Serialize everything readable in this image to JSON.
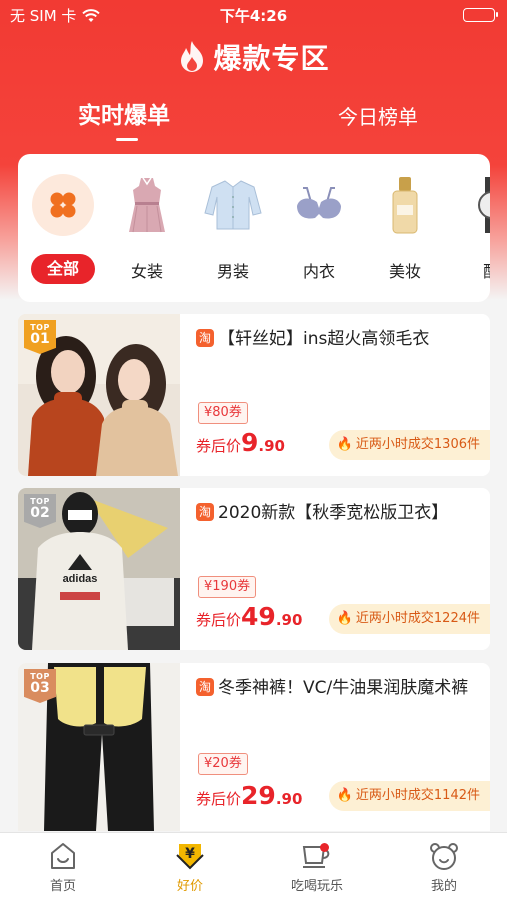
{
  "status_bar": {
    "carrier": "无 SIM 卡",
    "time": "下午4:26"
  },
  "header": {
    "title": "爆款专区"
  },
  "tabs": [
    {
      "label": "实时爆单",
      "active": true
    },
    {
      "label": "今日榜单",
      "active": false
    }
  ],
  "categories": [
    {
      "label": "全部",
      "icon": "clover-icon",
      "active": true
    },
    {
      "label": "女装",
      "icon": "dress-icon"
    },
    {
      "label": "男装",
      "icon": "shirt-icon"
    },
    {
      "label": "内衣",
      "icon": "bra-icon"
    },
    {
      "label": "美妆",
      "icon": "cosmetics-bottle-icon"
    },
    {
      "label": "配",
      "icon": "watch-icon"
    }
  ],
  "products": [
    {
      "rank_top": "TOP",
      "rank": "01",
      "rank_color": "#f0a020",
      "source_icon": "淘",
      "title": "【轩丝妃】ins超火高领毛衣",
      "coupon": "¥80券",
      "price_label": "券后价",
      "price_int": "9",
      "price_dec": ".90",
      "sales": "近两小时成交1306件"
    },
    {
      "rank_top": "TOP",
      "rank": "02",
      "rank_color": "#a9a9a9",
      "source_icon": "淘",
      "title": "2020新款【秋季宽松版卫衣】",
      "coupon": "¥190券",
      "price_label": "券后价",
      "price_int": "49",
      "price_dec": ".90",
      "sales": "近两小时成交1224件"
    },
    {
      "rank_top": "TOP",
      "rank": "03",
      "rank_color": "#d98c5f",
      "source_icon": "淘",
      "title": "冬季神裤！VC/牛油果润肤魔术裤",
      "coupon": "¥20券",
      "price_label": "券后价",
      "price_int": "29",
      "price_dec": ".90",
      "sales": "近两小时成交1142件"
    }
  ],
  "bottom_nav": [
    {
      "label": "首页",
      "icon": "home-icon"
    },
    {
      "label": "好价",
      "icon": "yen-coupon-icon",
      "active": true
    },
    {
      "label": "吃喝玩乐",
      "icon": "cup-icon",
      "has_dot": true
    },
    {
      "label": "我的",
      "icon": "bear-face-icon"
    }
  ],
  "colors": {
    "brand_red": "#f23a33",
    "accent_gold": "#e09a00",
    "price_red": "#e8242a"
  }
}
